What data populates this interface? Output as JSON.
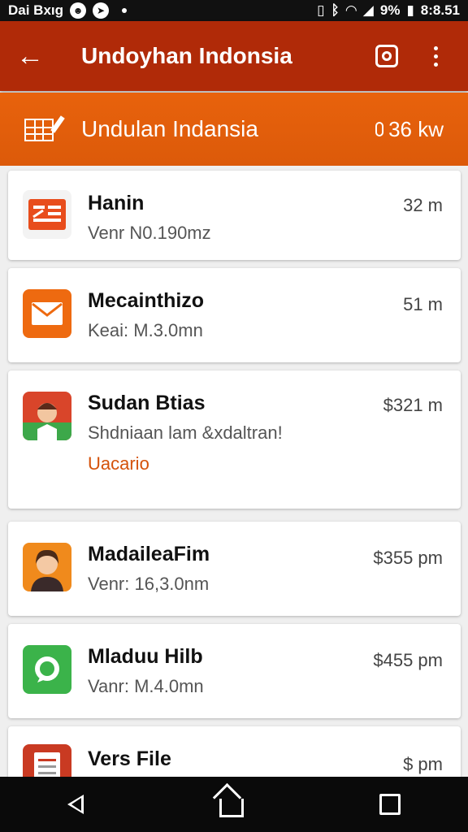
{
  "status_bar": {
    "left_text": "Dai Bxıg",
    "battery": "9%",
    "time": "8:8.51"
  },
  "app_bar": {
    "title": "Undoyhan Indonsia"
  },
  "sub_header": {
    "title": "Undulan Indansia",
    "size": "36 kw"
  },
  "items": [
    {
      "name": "Hanin",
      "sub": "Venr N0.190mz",
      "time": "32 m",
      "icon": "document-icon",
      "color": "#e84d1c"
    },
    {
      "name": "Mecainthizo",
      "sub": "Keai: M.3.0mn",
      "time": "51 m",
      "icon": "envelope-icon",
      "color": "#ee6a10"
    },
    {
      "name": "Sudan Btias",
      "sub": "Shdniaan lam &xdaltran!",
      "note": "Uacario",
      "time": "$321 m",
      "icon": "avatar-icon",
      "color": "#d9452a"
    },
    {
      "name": "MadaileaFim",
      "sub": "Venr: 16,3.0nm",
      "time": "$355 pm",
      "icon": "avatar-icon",
      "color": "#f08a1c"
    },
    {
      "name": "Mladuu Hilb",
      "sub": "Vanr: M.4.0mn",
      "time": "$455 pm",
      "icon": "chat-icon",
      "color": "#3bb34a"
    },
    {
      "name": "Vers File",
      "sub": "",
      "time": "$ pm",
      "icon": "file-icon",
      "color": "#c93a22"
    }
  ]
}
